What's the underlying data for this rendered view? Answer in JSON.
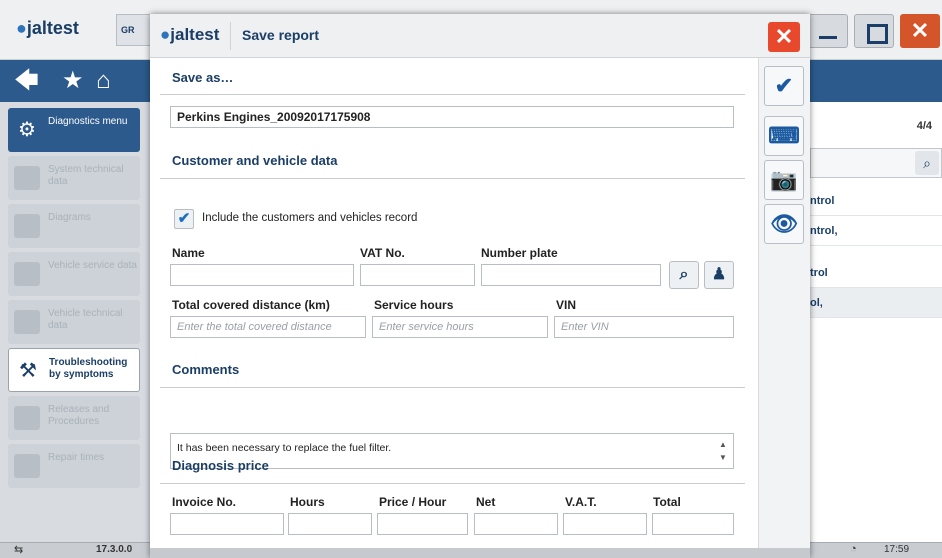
{
  "background": {
    "logo": {
      "dot": "●",
      "text": "jaltest"
    },
    "group_tab": "GR",
    "window_close": "✕",
    "nav": {
      "back_icon": "🡄",
      "star_icon": "★",
      "home_icon": "⌂"
    },
    "sidebar": [
      {
        "label": "Diagnostics menu",
        "icon": "gauge-icon"
      },
      {
        "label": "System technical data",
        "icon": "omega-icon"
      },
      {
        "label": "Diagrams",
        "icon": "diagram-icon"
      },
      {
        "label": "Vehicle service data",
        "icon": "vehicle-icon"
      },
      {
        "label": "Vehicle technical data",
        "icon": "wrench-icon"
      },
      {
        "label": "Troubleshooting by symptoms",
        "icon": "troubleshooting-icon"
      },
      {
        "label": "Releases and Procedures",
        "icon": "procedures-icon"
      },
      {
        "label": "Repair times",
        "icon": "repair-icon"
      }
    ],
    "right_panel": {
      "counter": "4/4",
      "items": [
        "ntrol",
        "ntrol,",
        "trol",
        "ol,"
      ]
    },
    "status": {
      "version": "17.3.0.0",
      "time": "17:59"
    }
  },
  "dialog": {
    "logo": {
      "dot": "●",
      "text": "jaltest"
    },
    "title": "Save report",
    "close": "✕",
    "save_as": {
      "title": "Save as…",
      "filename": "Perkins Engines_20092017175908"
    },
    "customer_section": {
      "title": "Customer and vehicle data",
      "include_checked": true,
      "include_label": "Include the customers and vehicles record",
      "labels": {
        "name": "Name",
        "vat": "VAT No.",
        "plate": "Number plate",
        "distance": "Total covered distance (km)",
        "hours": "Service hours",
        "vin": "VIN"
      },
      "placeholders": {
        "distance": "Enter the total covered distance",
        "hours": "Enter service hours",
        "vin": "Enter VIN"
      }
    },
    "comments": {
      "title": "Comments",
      "text": "It has been necessary to replace the fuel filter."
    },
    "price": {
      "title": "Diagnosis price",
      "columns": [
        "Invoice No.",
        "Hours",
        "Price / Hour",
        "Net",
        "V.A.T.",
        "Total"
      ]
    },
    "actions": [
      {
        "name": "confirm",
        "icon": "check-icon",
        "glyph": "✔"
      },
      {
        "name": "keyboard",
        "icon": "keyboard-icon",
        "glyph": "⌨"
      },
      {
        "name": "camera",
        "icon": "camera-icon",
        "glyph": "📷"
      },
      {
        "name": "preview",
        "icon": "eye-icon",
        "glyph": "👁"
      }
    ]
  },
  "colors": {
    "brand": "#1b3e66",
    "accent": "#2c5a8c",
    "close": "#e8492c"
  }
}
